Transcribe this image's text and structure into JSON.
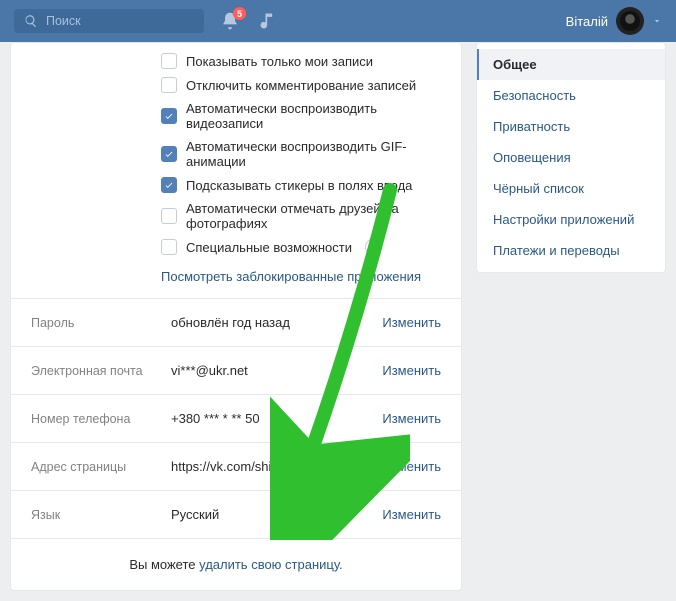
{
  "header": {
    "search_placeholder": "Поиск",
    "notif_badge": "5",
    "username": "Віталій"
  },
  "checks": [
    {
      "checked": false,
      "label": "Показывать только мои записи"
    },
    {
      "checked": false,
      "label": "Отключить комментирование записей"
    },
    {
      "checked": true,
      "label": "Автоматически воспроизводить видеозаписи"
    },
    {
      "checked": true,
      "label": "Автоматически воспроизводить GIF-анимации"
    },
    {
      "checked": true,
      "label": "Подсказывать стикеры в полях ввода"
    },
    {
      "checked": false,
      "label": "Автоматически отмечать друзей на фотографиях"
    },
    {
      "checked": false,
      "label": "Специальные возможности",
      "help": true
    }
  ],
  "apps_link": "Посмотреть заблокированные приложения",
  "rows": [
    {
      "label": "Пароль",
      "value": "обновлён год назад",
      "action": "Изменить"
    },
    {
      "label": "Электронная почта",
      "value": "vi***@ukr.net",
      "action": "Изменить"
    },
    {
      "label": "Номер телефона",
      "value": "+380 *** * ** 50",
      "action": "Изменить"
    },
    {
      "label": "Адрес страницы",
      "value": "https://vk.com/shipiloff_vitalik",
      "action": "Изменить"
    },
    {
      "label": "Язык",
      "value": "Русский",
      "action": "Изменить"
    }
  ],
  "footer": {
    "prefix": "Вы можете ",
    "link": "удалить свою страницу."
  },
  "sidebar": [
    {
      "label": "Общее",
      "active": true
    },
    {
      "label": "Безопасность"
    },
    {
      "label": "Приватность"
    },
    {
      "label": "Оповещения"
    },
    {
      "label": "Чёрный список"
    },
    {
      "label": "Настройки приложений"
    },
    {
      "label": "Платежи и переводы"
    }
  ],
  "colors": {
    "accent": "#5181b8",
    "link": "#2a5885",
    "arrow": "#2fbf2f"
  }
}
